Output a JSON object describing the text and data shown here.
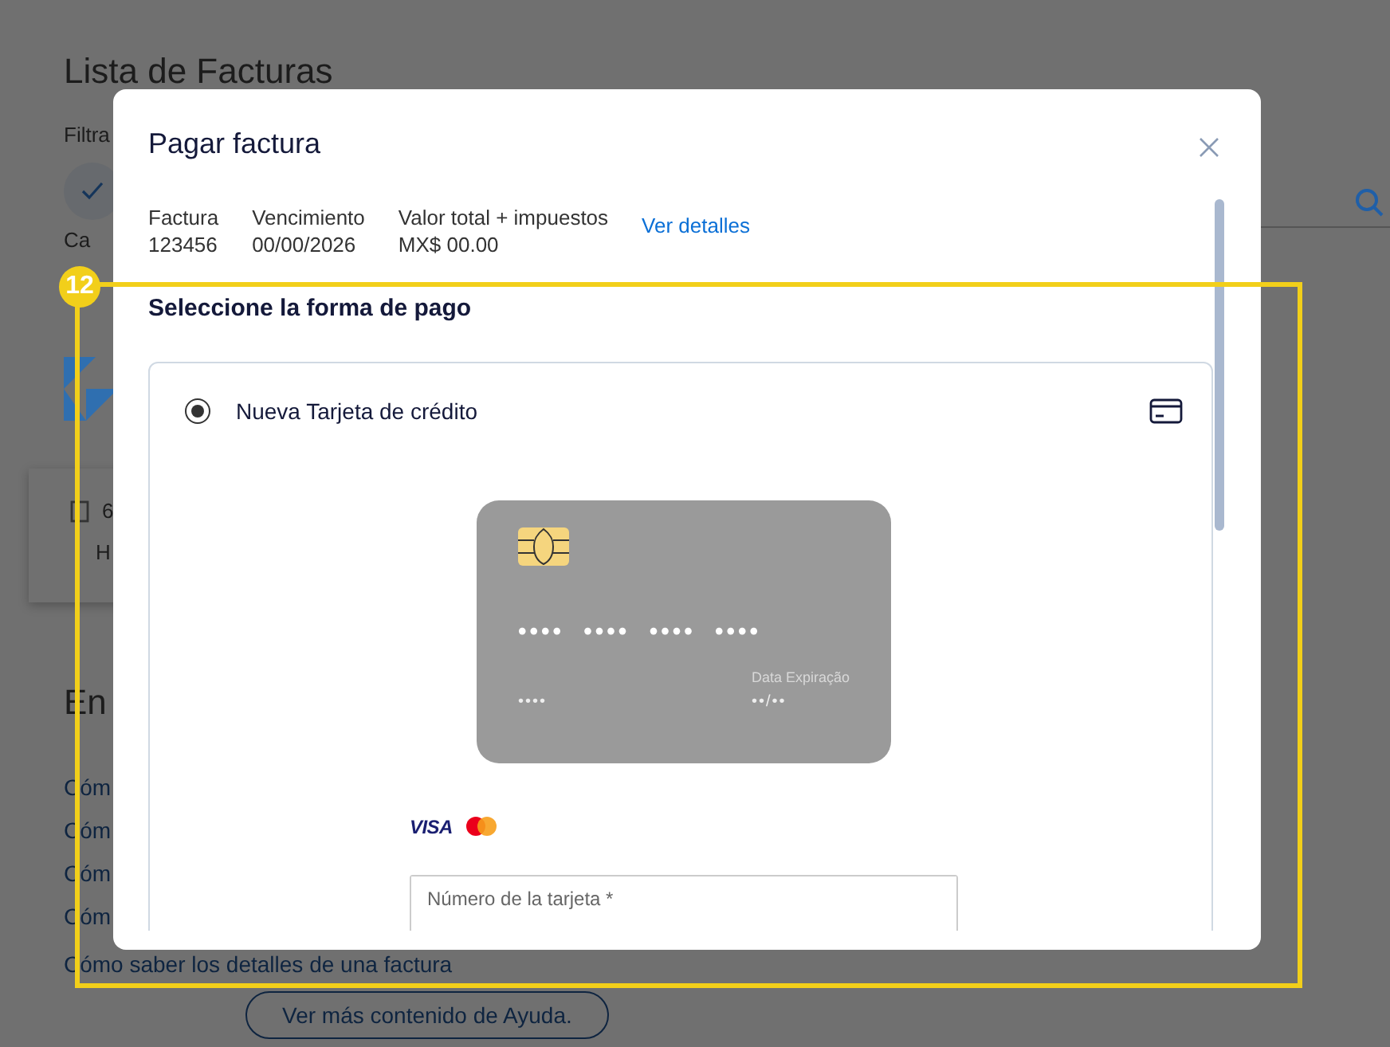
{
  "background_page": {
    "title": "Lista de Facturas",
    "filter_label": "Filtra",
    "tab_label": "Ca",
    "summary_card": {
      "value": "6",
      "label": "H"
    },
    "help_heading": "En",
    "help_links": [
      "Cóm",
      "Cóm",
      "Cóm",
      "Cóm",
      "Cómo saber los detalles de una factura"
    ],
    "more_help_button": "Ver más contenido de Ayuda."
  },
  "dialog": {
    "title": "Pagar factura",
    "info": [
      {
        "label": "Factura",
        "value": "123456"
      },
      {
        "label": "Vencimiento",
        "value": "00/00/2026"
      },
      {
        "label": "Valor total + impuestos",
        "value": "MX$ 00.00"
      }
    ],
    "details_link": "Ver detalles",
    "section_title": "Seleccione la forma de pago",
    "payment_options": [
      {
        "label": "Nueva Tarjeta de crédito",
        "selected": true
      }
    ],
    "card_preview": {
      "number": "•••• •••• •••• ••••",
      "cvv": "••••",
      "expiry_label": "Data Expiração",
      "expiry": "••/••"
    },
    "brands": [
      {
        "kind": "visa",
        "text": "VISA"
      },
      {
        "kind": "mastercard"
      }
    ],
    "card_number_field": {
      "placeholder": "Número de la tarjeta *"
    }
  },
  "annotation": {
    "label": "12"
  }
}
